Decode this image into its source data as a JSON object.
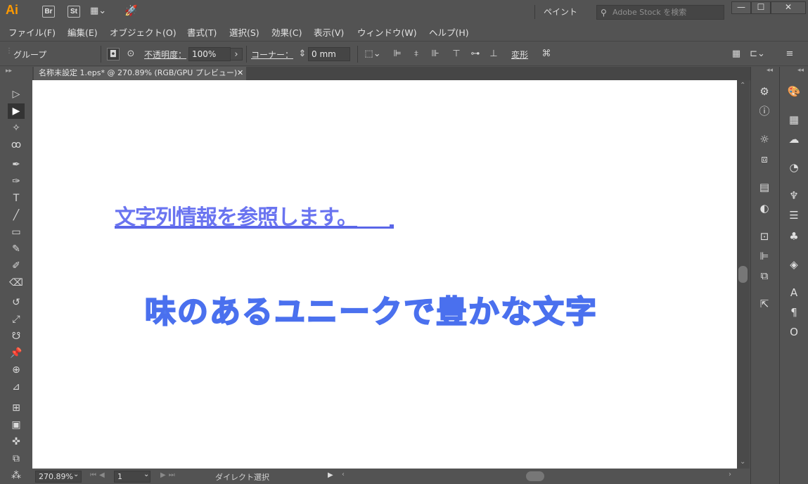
{
  "titlebar": {
    "logo": "Ai",
    "apps": [
      "Br",
      "St"
    ],
    "workspace": "ペイント ⌄",
    "stock_placeholder": "Adobe Stock を検索",
    "min": "—",
    "max": "☐",
    "close": "✕"
  },
  "menu": [
    "ファイル(F)",
    "編集(E)",
    "オブジェクト(O)",
    "書式(T)",
    "選択(S)",
    "効果(C)",
    "表示(V)",
    "ウィンドウ(W)",
    "ヘルプ(H)"
  ],
  "control": {
    "selection": "グループ",
    "opacity_label": "不透明度：",
    "opacity_value": "100%",
    "corner_label": "コーナー：",
    "corner_value": "0 mm",
    "transform_label": "変形"
  },
  "document": {
    "tab_title": "名称未設定  1.eps* @ 270.89% (RGB/GPU プレビュー)",
    "close": "✕"
  },
  "canvas": {
    "text1": "文字列情報を参照します。",
    "text2": "味のあるユニークで豊かな文字"
  },
  "status": {
    "zoom": "270.89%",
    "page": "1",
    "tool": "ダイレクト選択"
  }
}
